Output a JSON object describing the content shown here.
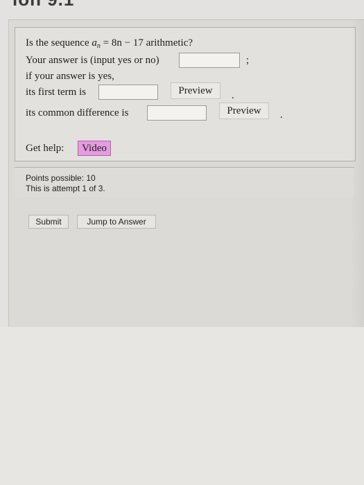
{
  "page": {
    "heading_fragment": "ion 9.1"
  },
  "question": {
    "intro": "Is the sequence",
    "seq_var": "a",
    "seq_sub": "n",
    "equals": "=",
    "formula": "8n − 17 arithmetic?",
    "line2": "Your answer is (input yes or no)",
    "line2_punct": ";",
    "line3": "if your answer is yes,",
    "line4": "its first term is",
    "line4_punct": ".",
    "line5": "its common difference is",
    "line5_punct": ".",
    "preview_label": "Preview",
    "help_label": "Get help:",
    "video_label": "Video",
    "answer_yes_no": "",
    "answer_first_term": "",
    "answer_difference": ""
  },
  "info": {
    "points": "Points possible: 10",
    "attempt": "This is attempt 1 of 3."
  },
  "actions": {
    "submit": "Submit",
    "jump": "Jump to Answer"
  },
  "colors": {
    "video_button": "#e59be0",
    "panel_bg": "#dcdad6"
  }
}
